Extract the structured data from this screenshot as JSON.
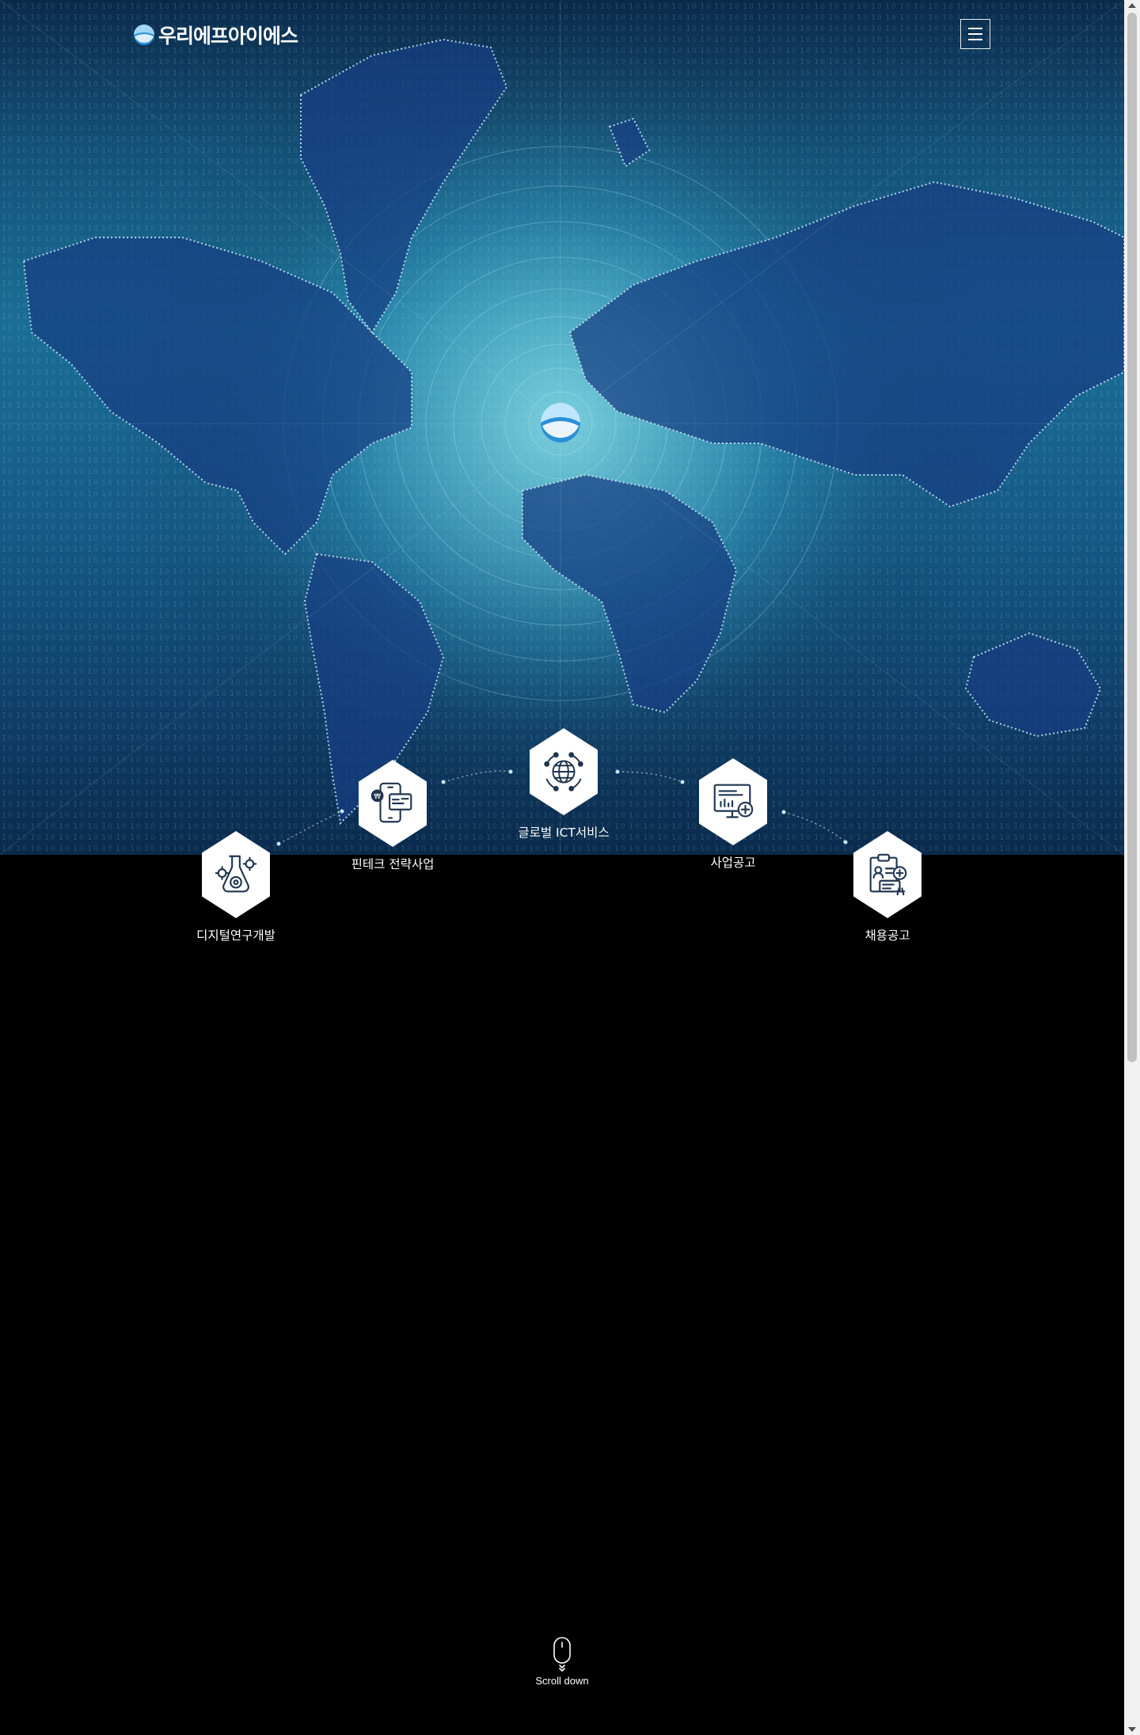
{
  "header": {
    "logo_text": "우리에프아이에스",
    "menu_icon": "hamburger-menu-icon"
  },
  "services": [
    {
      "label": "디지털연구개발",
      "icon": "digital-research-icon"
    },
    {
      "label": "핀테크 전략사업",
      "icon": "fintech-mobile-icon"
    },
    {
      "label": "글로벌 ICT서비스",
      "icon": "global-network-icon"
    },
    {
      "label": "사업공고",
      "icon": "monitor-plus-icon"
    },
    {
      "label": "채용공고",
      "icon": "recruit-document-icon"
    }
  ],
  "scroll": {
    "label": "Scroll down",
    "icon": "mouse-scroll-icon"
  },
  "colors": {
    "hero_dark": "#0b2a4a",
    "hero_light": "#1a6e96",
    "page_bg": "#000000",
    "hex_bg": "#ffffff",
    "icon_stroke": "#1f3550"
  }
}
